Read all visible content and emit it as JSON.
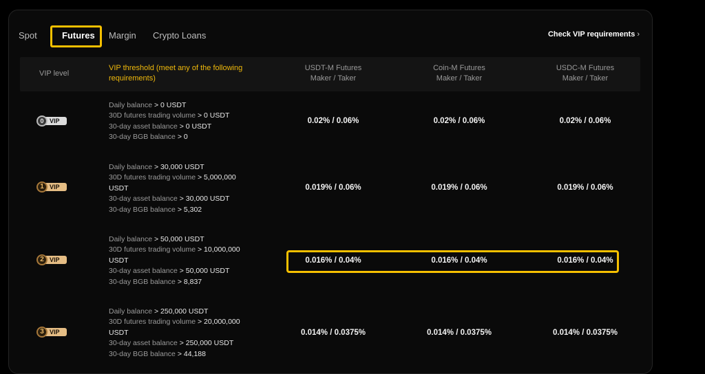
{
  "tabs": [
    {
      "label": "Spot",
      "active": false
    },
    {
      "label": "Futures",
      "active": true
    },
    {
      "label": "Margin",
      "active": false
    },
    {
      "label": "Crypto Loans",
      "active": false
    }
  ],
  "check_link": {
    "label": "Check VIP requirements",
    "chevron": "›"
  },
  "header": {
    "vip_level": "VIP level",
    "threshold_line1": "VIP threshold (meet any of the following",
    "threshold_line2": "requirements)",
    "col1_line1": "USDT-M Futures",
    "col2_line1": "Coin-M Futures",
    "col3_line1": "USDC-M Futures",
    "maker_taker": "Maker / Taker"
  },
  "accent_color": "#f0b90b",
  "highlight_color": "#f6c000",
  "rows": [
    {
      "level": "0",
      "badge_text": "VIP",
      "req": {
        "l1_label": "Daily balance",
        "l1_value": " > 0 USDT",
        "l2_label": "30D futures trading volume",
        "l2_value": " > 0 USDT",
        "l2b": "",
        "l3_label": "30-day asset balance",
        "l3_value": " > 0 USDT",
        "l4_label": "30-day BGB balance",
        "l4_value": " > 0"
      },
      "usdt_m": "0.02% / 0.06%",
      "coin_m": "0.02% / 0.06%",
      "usdc_m": "0.02% / 0.06%"
    },
    {
      "level": "1",
      "badge_text": "VIP",
      "req": {
        "l1_label": "Daily balance",
        "l1_value": " > 30,000 USDT",
        "l2_label": "30D futures trading volume",
        "l2_value": " > 5,000,000",
        "l2b": "USDT",
        "l3_label": "30-day asset balance",
        "l3_value": " > 30,000 USDT",
        "l4_label": "30-day BGB balance",
        "l4_value": " > 5,302"
      },
      "usdt_m": "0.019% / 0.06%",
      "coin_m": "0.019% / 0.06%",
      "usdc_m": "0.019% / 0.06%"
    },
    {
      "level": "2",
      "badge_text": "VIP",
      "req": {
        "l1_label": "Daily balance",
        "l1_value": " > 50,000 USDT",
        "l2_label": "30D futures trading volume",
        "l2_value": " > 10,000,000",
        "l2b": "USDT",
        "l3_label": "30-day asset balance",
        "l3_value": " > 50,000 USDT",
        "l4_label": "30-day BGB balance",
        "l4_value": " > 8,837"
      },
      "usdt_m": "0.016% / 0.04%",
      "coin_m": "0.016% / 0.04%",
      "usdc_m": "0.016% / 0.04%"
    },
    {
      "level": "3",
      "badge_text": "VIP",
      "req": {
        "l1_label": "Daily balance",
        "l1_value": " > 250,000 USDT",
        "l2_label": "30D futures trading volume",
        "l2_value": " > 20,000,000",
        "l2b": "USDT",
        "l3_label": "30-day asset balance",
        "l3_value": " > 250,000 USDT",
        "l4_label": "30-day BGB balance",
        "l4_value": " > 44,188"
      },
      "usdt_m": "0.014% / 0.0375%",
      "coin_m": "0.014% / 0.0375%",
      "usdc_m": "0.014% / 0.0375%"
    }
  ]
}
